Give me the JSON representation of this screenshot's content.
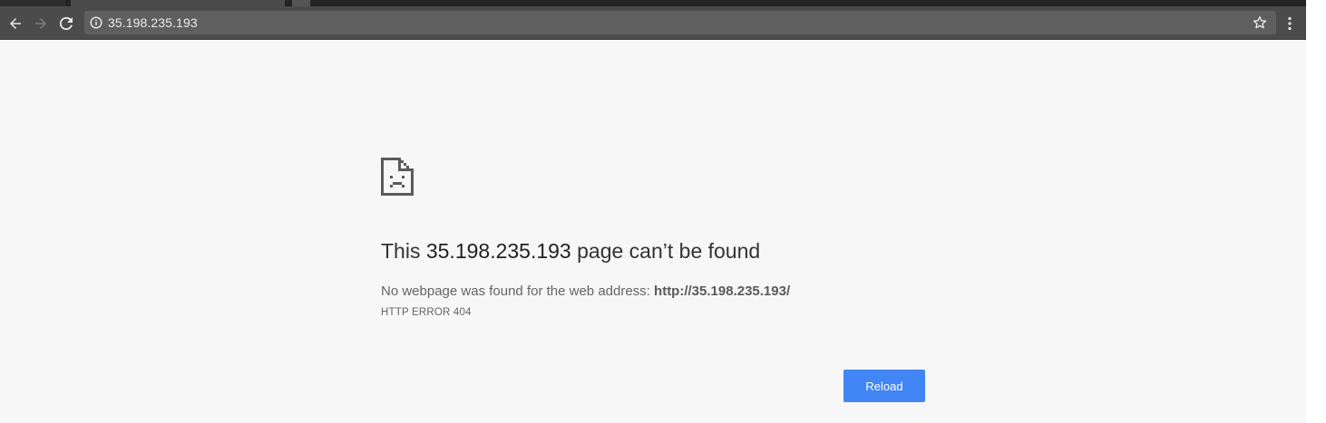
{
  "browser": {
    "url": "35.198.235.193",
    "colors": {
      "toolbar": "#4b4b4b",
      "omnibox": "#5f5f5f",
      "page_background": "#f7f7f7",
      "button_blue": "#4285f4"
    },
    "icons": {
      "back": "back-arrow-icon",
      "forward": "forward-arrow-icon",
      "reload": "reload-icon",
      "info": "info-icon",
      "bookmark": "star-icon",
      "menu": "kebab-menu-icon"
    }
  },
  "error_page": {
    "icon": "sad-page-icon",
    "heading_prefix": "This ",
    "heading_host": "35.198.235.193",
    "heading_suffix": " page can’t be found",
    "description_text": "No webpage was found for the web address: ",
    "description_address": "http://35.198.235.193/",
    "error_code": "HTTP ERROR 404",
    "reload_label": "Reload"
  }
}
